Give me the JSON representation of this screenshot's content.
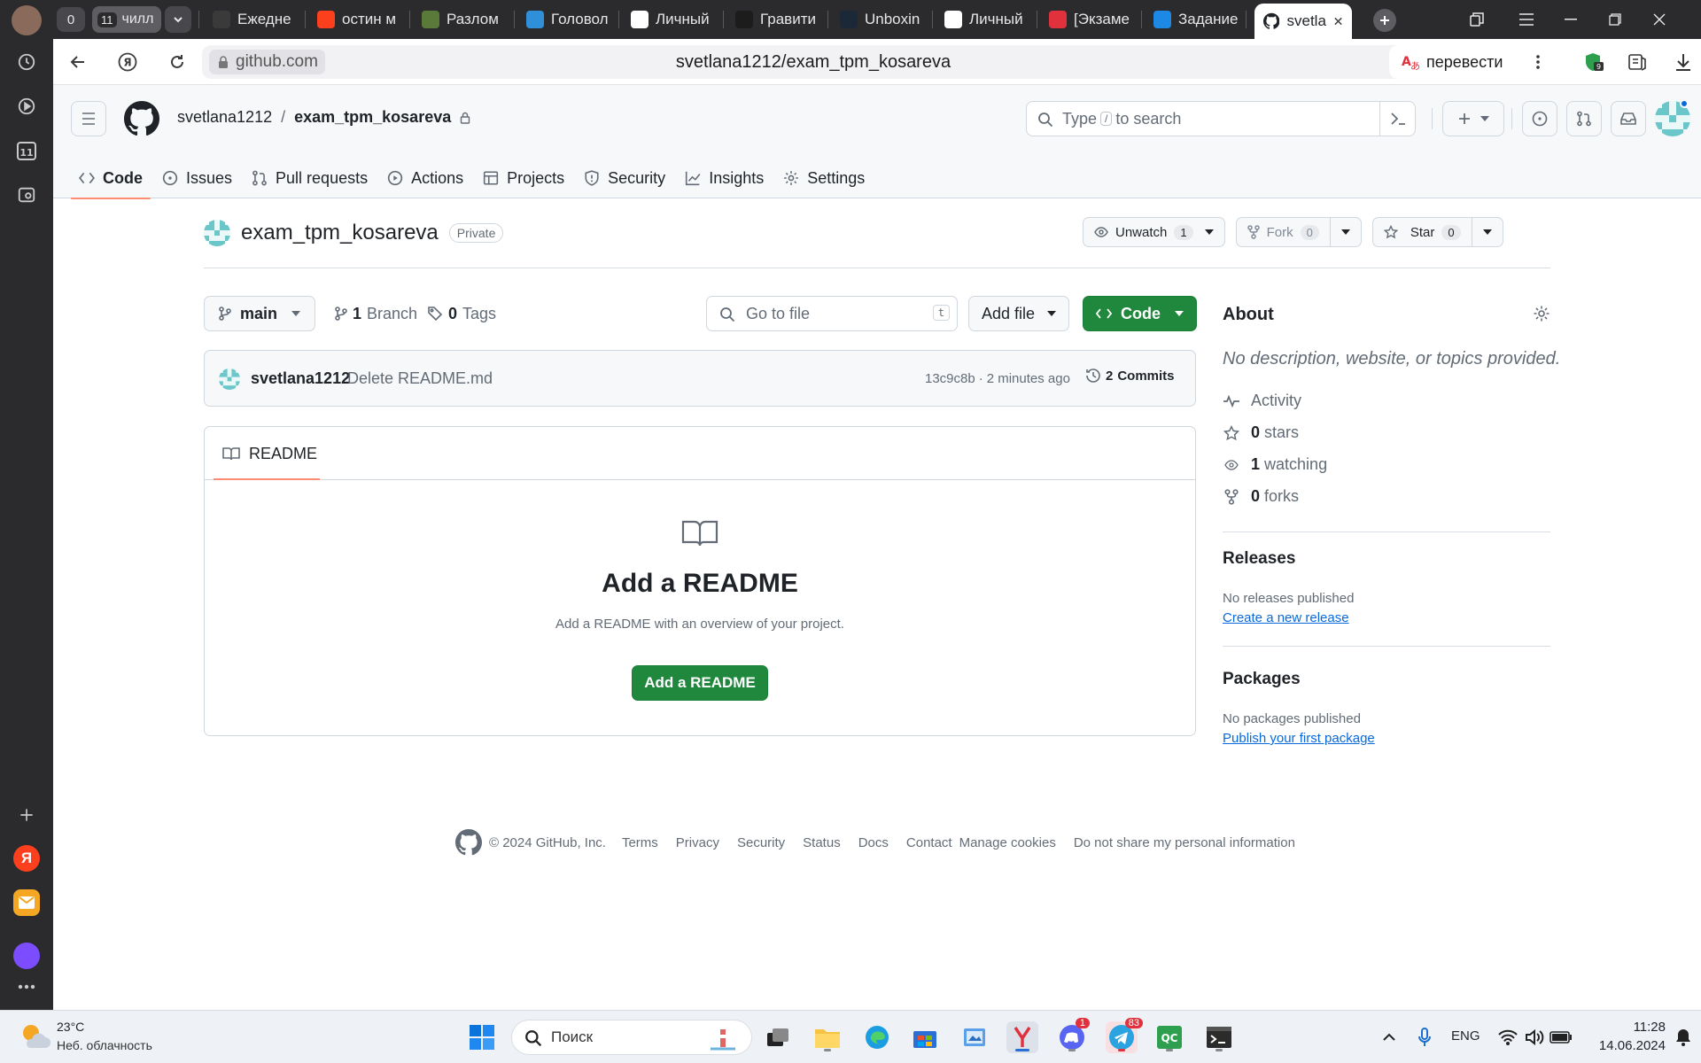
{
  "browser": {
    "tab_counter": "0",
    "group_count": "11",
    "group_label": "чилл",
    "tabs": [
      {
        "label": "Ежедне",
        "color": "#3a3a3a"
      },
      {
        "label": "остин м",
        "color": "#fc3f1d"
      },
      {
        "label": "Разлом",
        "color": "#5a7a3a"
      },
      {
        "label": "Головол",
        "color": "#2f8fd8"
      },
      {
        "label": "Личный",
        "color": "#ffffff"
      },
      {
        "label": "Гравити",
        "color": "#1c1c1c"
      },
      {
        "label": "Unboxin",
        "color": "#1b2838"
      },
      {
        "label": "Личный",
        "color": "#ffffff"
      },
      {
        "label": "[Экзаме",
        "color": "#e0313c"
      },
      {
        "label": "Задание",
        "color": "#1e88e5"
      }
    ],
    "active_tab": "svetla",
    "domain": "github.com",
    "page_title": "svetlana1212/exam_tpm_kosareva",
    "translate_label": "перевести",
    "extension_badge": "9"
  },
  "header": {
    "owner": "svetlana1212",
    "separator": "/",
    "repo": "exam_tpm_kosareva",
    "search_placeholder_pre": "Type",
    "search_key": "/",
    "search_placeholder_post": "to search"
  },
  "repo_nav": [
    {
      "label": "Code",
      "icon": "code-icon",
      "active": true
    },
    {
      "label": "Issues",
      "icon": "issue-icon"
    },
    {
      "label": "Pull requests",
      "icon": "pull-request-icon"
    },
    {
      "label": "Actions",
      "icon": "play-icon"
    },
    {
      "label": "Projects",
      "icon": "table-icon"
    },
    {
      "label": "Security",
      "icon": "shield-icon"
    },
    {
      "label": "Insights",
      "icon": "graph-icon"
    },
    {
      "label": "Settings",
      "icon": "gear-icon"
    }
  ],
  "repo": {
    "name": "exam_tpm_kosareva",
    "visibility": "Private",
    "unwatch_label": "Unwatch",
    "watch_count": "1",
    "fork_label": "Fork",
    "fork_count": "0",
    "star_label": "Star",
    "star_count": "0"
  },
  "filebar": {
    "branch": "main",
    "branch_count": "1",
    "branch_label": "Branch",
    "tag_count": "0",
    "tag_label": "Tags",
    "goto_placeholder": "Go to file",
    "goto_key": "t",
    "add_file": "Add file",
    "code_button": "Code"
  },
  "commit": {
    "author": "svetlana1212",
    "message": "Delete README.md",
    "sha": "13c9c8b",
    "separator": "·",
    "time": "2 minutes ago",
    "commits_count": "2",
    "commits_label": "Commits"
  },
  "readme": {
    "tab": "README",
    "heading": "Add a README",
    "description": "Add a README with an overview of your project.",
    "button": "Add a README"
  },
  "about": {
    "title": "About",
    "description": "No description, website, or topics provided.",
    "activity": "Activity",
    "stars_count": "0",
    "stars_label": "stars",
    "watching_count": "1",
    "watching_label": "watching",
    "forks_count": "0",
    "forks_label": "forks",
    "releases_title": "Releases",
    "releases_text": "No releases published",
    "releases_link": "Create a new release",
    "packages_title": "Packages",
    "packages_text": "No packages published",
    "packages_link": "Publish your first package"
  },
  "footer": {
    "copyright": "© 2024 GitHub, Inc.",
    "links": [
      "Terms",
      "Privacy",
      "Security",
      "Status",
      "Docs",
      "Contact",
      "Manage cookies",
      "Do not share my personal information"
    ]
  },
  "taskbar": {
    "temperature": "23°C",
    "weather": "Неб. облачность",
    "search_label": "Поиск",
    "lang": "ENG",
    "time": "11:28",
    "date": "14.06.2024",
    "discord_badge": "1",
    "telegram_badge": "83"
  }
}
